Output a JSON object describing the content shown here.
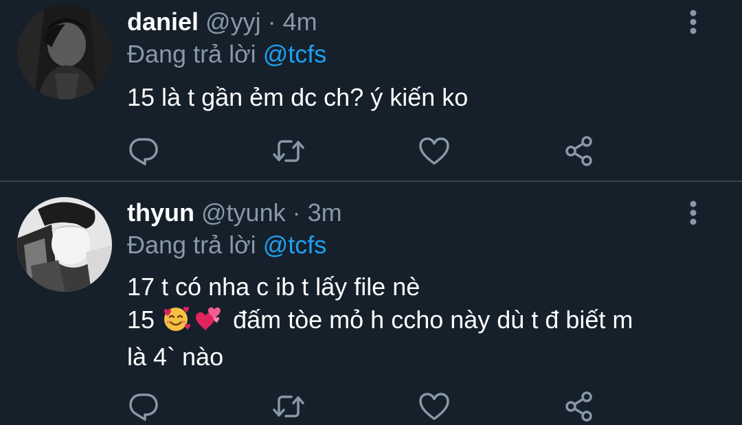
{
  "colors": {
    "background": "#15202b",
    "name_text": "#ffffff",
    "secondary_text": "#8899a6",
    "mention": "#1da1f2",
    "divider": "#38444d",
    "icon": "#8899a6"
  },
  "tweets": [
    {
      "name": "daniel",
      "handle": "@yyj",
      "separator": "·",
      "time": "4m",
      "reply_prefix": "Đang trả lời",
      "reply_to": "@tcfs",
      "text_lines": [
        "15 là t gần ẻm dc ch? ý kiến ko"
      ],
      "avatar_icon": "avatar-photo"
    },
    {
      "name": "thyun",
      "handle": "@tyunk",
      "separator": "·",
      "time": "3m",
      "reply_prefix": "Đang trả lời",
      "reply_to": "@tcfs",
      "text_lines": [
        "17 t có nha c ib t lấy file nè",
        "15",
        "đấm tòe mỏ h ccho này dù t đ biết m",
        "là 4` nào"
      ],
      "emoji": [
        "smiling-face-with-hearts-emoji",
        "two-hearts-emoji"
      ],
      "avatar_icon": "avatar-photo"
    }
  ],
  "actions": {
    "reply_icon": "reply-icon",
    "retweet_icon": "retweet-icon",
    "like_icon": "heart-icon",
    "share_icon": "share-icon",
    "more_icon": "more-options-icon"
  }
}
